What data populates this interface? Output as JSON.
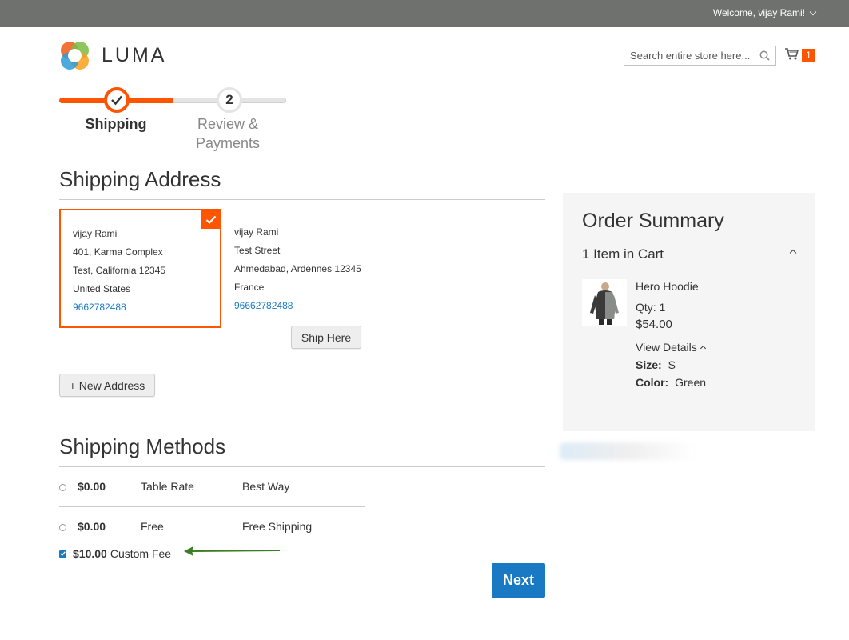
{
  "header": {
    "welcome_text": "Welcome, vijay Rami!",
    "logo_text": "LUMA",
    "search_placeholder": "Search entire store here...",
    "cart_count": "1"
  },
  "progress": {
    "steps": [
      {
        "number": "1",
        "label": "Shipping",
        "status": "complete"
      },
      {
        "number": "2",
        "label": "Review & Payments",
        "status": "pending"
      }
    ]
  },
  "shipping_address": {
    "title": "Shipping Address",
    "addresses": [
      {
        "name": "vijay Rami",
        "street": "401, Karma Complex",
        "city_line": "Test, California 12345",
        "country": "United States",
        "phone": "9662782488",
        "selected": true
      },
      {
        "name": "vijay Rami",
        "street": "Test Street",
        "city_line": "Ahmedabad, Ardennes 12345",
        "country": "France",
        "phone": "96662782488",
        "selected": false
      }
    ],
    "ship_here_label": "Ship Here",
    "new_address_label": "+ New Address"
  },
  "shipping_methods": {
    "title": "Shipping Methods",
    "rows": [
      {
        "price": "$0.00",
        "carrier": "Table Rate",
        "method": "Best Way"
      },
      {
        "price": "$0.00",
        "carrier": "Free",
        "method": "Free Shipping"
      }
    ],
    "custom_fee": {
      "price": "$10.00",
      "label": "Custom Fee",
      "checked": true
    }
  },
  "next_label": "Next",
  "order_summary": {
    "title": "Order Summary",
    "items_in_cart": "1 Item in Cart",
    "product": {
      "name": "Hero Hoodie",
      "qty": "Qty: 1",
      "price": "$54.00",
      "view_details": "View Details",
      "size_label": "Size:",
      "size_value": "S",
      "color_label": "Color:",
      "color_value": "Green"
    }
  },
  "colors": {
    "accent": "#ff5501",
    "link": "#1979c3",
    "topbar": "#6e716e",
    "arrow": "#3a7d22"
  }
}
